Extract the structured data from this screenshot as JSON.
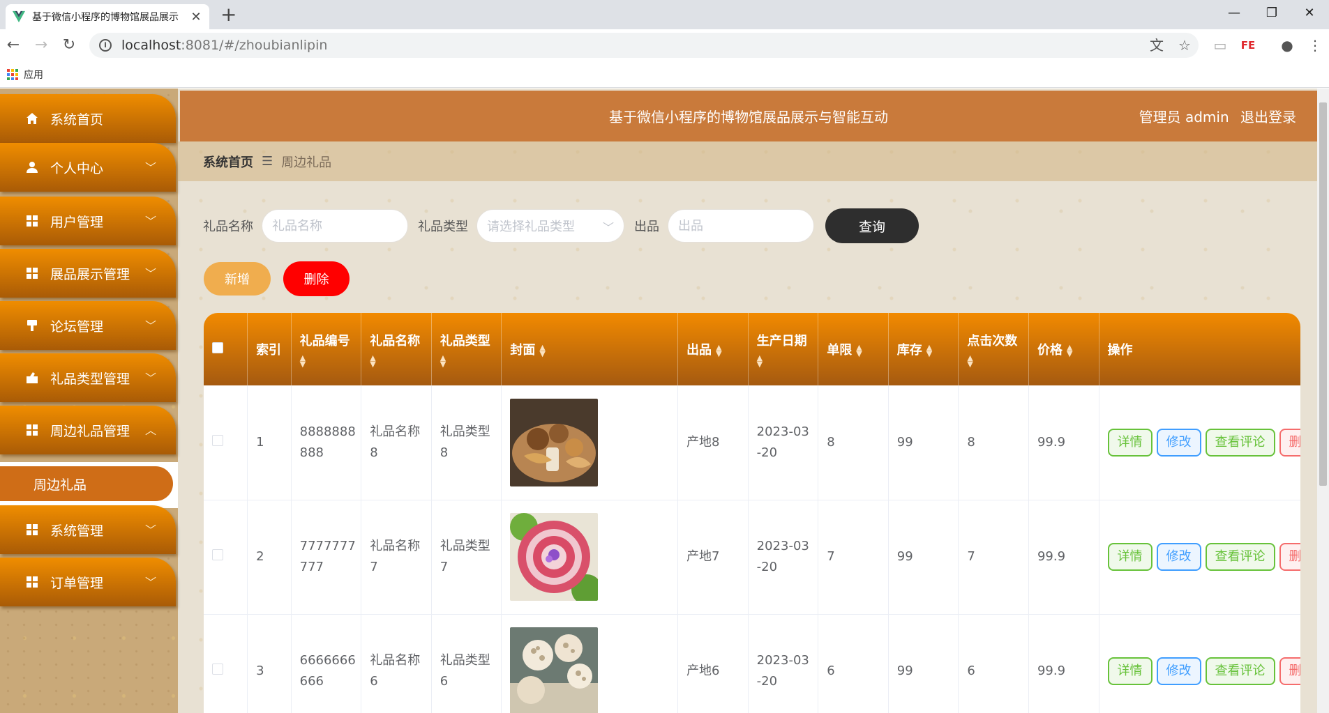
{
  "browser": {
    "tab_title": "基于微信小程序的博物馆展品展示",
    "url_host": "localhost",
    "url_path": ":8081/#/zhoubianlipin",
    "bookmark_apps": "应用"
  },
  "colors": {
    "accent": "#f08d00",
    "header": "#c97a3b",
    "danger": "#ff0000",
    "add": "#f0ad4e"
  },
  "sidebar": {
    "items": [
      {
        "label": "系统首页",
        "icon": "home-icon",
        "expandable": false
      },
      {
        "label": "个人中心",
        "icon": "user-icon",
        "expandable": true
      },
      {
        "label": "用户管理",
        "icon": "grid-icon",
        "expandable": true
      },
      {
        "label": "展品展示管理",
        "icon": "grid-icon",
        "expandable": true
      },
      {
        "label": "论坛管理",
        "icon": "forum-icon",
        "expandable": true
      },
      {
        "label": "礼品类型管理",
        "icon": "gift-type-icon",
        "expandable": true
      },
      {
        "label": "周边礼品管理",
        "icon": "grid-icon",
        "expandable": true,
        "expanded": true
      },
      {
        "label": "系统管理",
        "icon": "grid-icon",
        "expandable": true
      },
      {
        "label": "订单管理",
        "icon": "grid-icon",
        "expandable": true
      }
    ],
    "active_sub": "周边礼品"
  },
  "header": {
    "title": "基于微信小程序的博物馆展品展示与智能互动",
    "user": "管理员 admin",
    "logout": "退出登录"
  },
  "breadcrumb": {
    "home": "系统首页",
    "current": "周边礼品"
  },
  "search": {
    "name_label": "礼品名称",
    "name_placeholder": "礼品名称",
    "type_label": "礼品类型",
    "type_placeholder": "请选择礼品类型",
    "origin_label": "出品",
    "origin_placeholder": "出品",
    "query": "查询"
  },
  "actions": {
    "add": "新增",
    "delete": "删除"
  },
  "table": {
    "columns": [
      "索引",
      "礼品编号",
      "礼品名称",
      "礼品类型",
      "封面",
      "出品",
      "生产日期",
      "单限",
      "库存",
      "点击次数",
      "价格",
      "操作"
    ],
    "rows": [
      {
        "index": "1",
        "code_a": "8888888",
        "code_b": "888",
        "name_a": "礼品名称",
        "name_b": "8",
        "type_a": "礼品类型",
        "type_b": "8",
        "cover": "mushroom-photo",
        "origin": "产地8",
        "date_a": "2023-03",
        "date_b": "-20",
        "limit": "8",
        "stock": "99",
        "clicks": "8",
        "price": "99.9"
      },
      {
        "index": "2",
        "code_a": "7777777",
        "code_b": "777",
        "name_a": "礼品名称",
        "name_b": "7",
        "type_a": "礼品类型",
        "type_b": "7",
        "cover": "meat-photo",
        "origin": "产地7",
        "date_a": "2023-03",
        "date_b": "-20",
        "limit": "7",
        "stock": "99",
        "clicks": "7",
        "price": "99.9"
      },
      {
        "index": "3",
        "code_a": "6666666",
        "code_b": "666",
        "name_a": "礼品名称",
        "name_b": "6",
        "type_a": "礼品类型",
        "type_b": "6",
        "cover": "lotus-photo",
        "origin": "产地6",
        "date_a": "2023-03",
        "date_b": "-20",
        "limit": "6",
        "stock": "99",
        "clicks": "6",
        "price": "99.9"
      }
    ],
    "row_actions": {
      "detail": "详情",
      "edit": "修改",
      "comment": "查看评论",
      "delete": "删除"
    }
  }
}
